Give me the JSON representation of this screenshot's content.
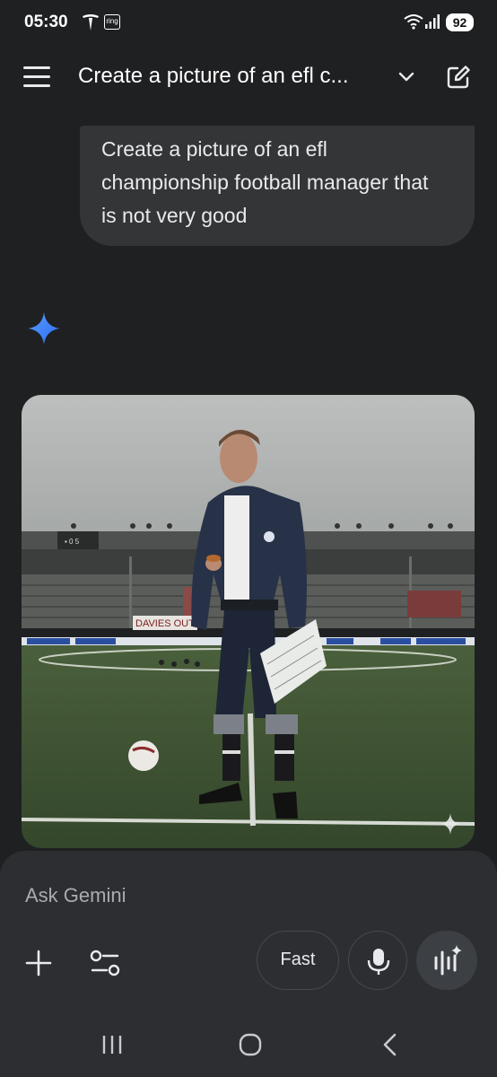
{
  "status_bar": {
    "time": "05:30",
    "ring_label": "ring",
    "battery": "92"
  },
  "header": {
    "title": "Create a picture of an efl c..."
  },
  "prompt": {
    "text": "Create a picture of an efl championship football manager that is not very good"
  },
  "image": {
    "banner_text": "DAVIES OUT"
  },
  "composer": {
    "placeholder": "Ask Gemini",
    "mode_label": "Fast"
  }
}
